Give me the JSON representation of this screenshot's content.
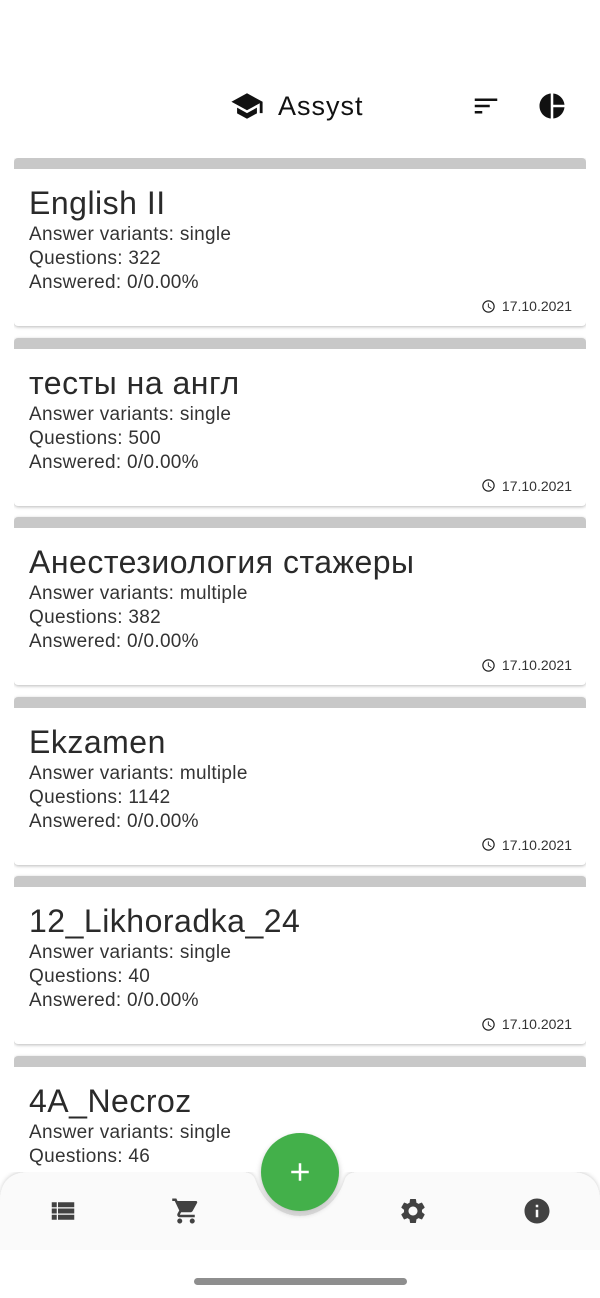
{
  "header": {
    "title": "Assyst",
    "logo_icon": "graduation-cap-icon",
    "sort_icon": "sort-icon",
    "stats_icon": "pie-chart-icon"
  },
  "tests": [
    {
      "title": "English II",
      "variants": "Answer variants: single",
      "questions": "Questions: 322",
      "answered": "Answered: 0/0.00%",
      "date": "17.10.2021"
    },
    {
      "title": "тесты на англ",
      "variants": "Answer variants: single",
      "questions": "Questions: 500",
      "answered": "Answered: 0/0.00%",
      "date": "17.10.2021"
    },
    {
      "title": "Анестезиология стажеры",
      "variants": "Answer variants: multiple",
      "questions": "Questions: 382",
      "answered": "Answered: 0/0.00%",
      "date": "17.10.2021"
    },
    {
      "title": "Ekzamen",
      "variants": "Answer variants: multiple",
      "questions": "Questions: 1142",
      "answered": "Answered: 0/0.00%",
      "date": "17.10.2021"
    },
    {
      "title": "12_Likhoradka_24",
      "variants": "Answer variants: single",
      "questions": "Questions: 40",
      "answered": "Answered: 0/0.00%",
      "date": "17.10.2021"
    },
    {
      "title": "4A_Necroz",
      "variants": "Answer variants: single",
      "questions": "Questions: 46",
      "answered": "",
      "date": ""
    }
  ],
  "bottom_nav": {
    "items": [
      "list-icon",
      "cart-icon",
      "settings-icon",
      "info-icon"
    ],
    "fab_icon": "plus-icon"
  },
  "colors": {
    "fab": "#43b04a",
    "card_bar": "#c8c8c8",
    "icons": "#424242"
  }
}
